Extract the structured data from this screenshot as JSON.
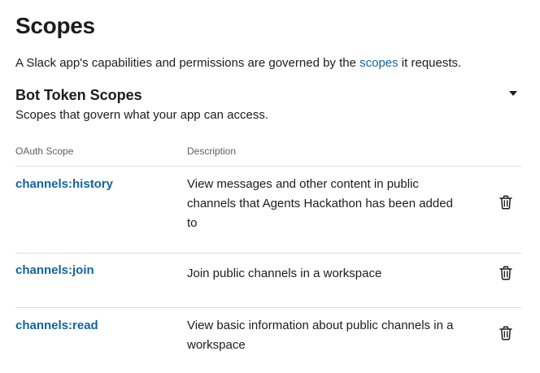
{
  "header": {
    "title": "Scopes",
    "intro_prefix": "A Slack app's capabilities and permissions are governed by the ",
    "intro_link": "scopes",
    "intro_suffix": " it requests."
  },
  "section": {
    "title": "Bot Token Scopes",
    "subtitle": "Scopes that govern what your app can access.",
    "toggle_icon": "caret-down-icon"
  },
  "table": {
    "columns": [
      "OAuth Scope",
      "Description"
    ],
    "rows": [
      {
        "scope": "channels:history",
        "description": "View messages and other content in public channels that Agents Hackathon has been added to",
        "action_icon": "trash-icon"
      },
      {
        "scope": "channels:join",
        "description": "Join public channels in a workspace",
        "action_icon": "trash-icon"
      },
      {
        "scope": "channels:read",
        "description": "View basic information about public channels in a workspace",
        "action_icon": "trash-icon"
      }
    ]
  },
  "colors": {
    "link": "#1264a3",
    "text": "#1d1c1d",
    "muted": "#616061",
    "divider": "#dddddd"
  }
}
